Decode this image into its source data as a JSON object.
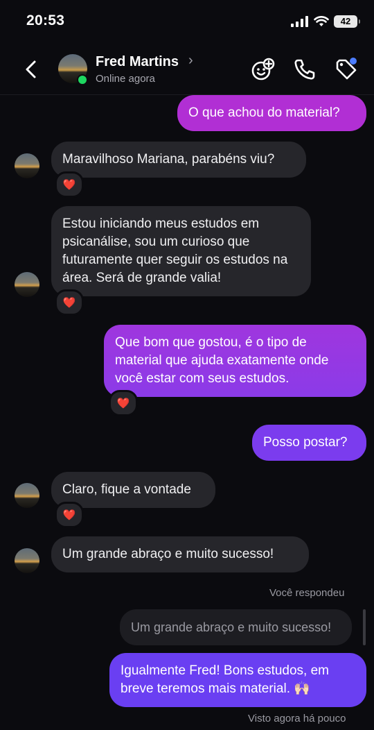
{
  "status_bar": {
    "time": "20:53",
    "battery": "42",
    "icons": [
      "signal-icon",
      "wifi-icon",
      "battery-icon"
    ]
  },
  "header": {
    "contact_name": "Fred Martins",
    "contact_status": "Online agora",
    "icons": [
      "back-icon",
      "effects-icon",
      "phone-icon",
      "tag-icon"
    ]
  },
  "colors": {
    "background": "#0b0b0f",
    "incoming_bubble": "#26262b",
    "outgoing_top": "#b12fd4",
    "outgoing_bottom": "#6a3ff2",
    "online": "#1ed760",
    "badge": "#4c7dff"
  },
  "messages": [
    {
      "side": "outgoing",
      "text": "O que achou do material?"
    },
    {
      "side": "incoming",
      "text": "Maravilhoso Mariana, parabéns viu?",
      "reaction": "❤️"
    },
    {
      "side": "incoming",
      "text": "Estou iniciando meus estudos em psicanálise, sou um curioso que futuramente quer seguir os estudos na área. Será de grande valia!",
      "reaction": "❤️"
    },
    {
      "side": "outgoing",
      "text": "Que bom que gostou, é o tipo de material que ajuda exatamente onde você estar com seus estudos.",
      "reaction": "❤️"
    },
    {
      "side": "outgoing",
      "text": "Posso postar?"
    },
    {
      "side": "incoming",
      "text": "Claro, fique a vontade",
      "reaction": "❤️"
    },
    {
      "side": "incoming",
      "text": "Um grande abraço e muito sucesso!"
    },
    {
      "side": "outgoing",
      "text": "Igualmente Fred! Bons estudos, em breve teremos mais material. 🙌🏻"
    }
  ],
  "reply": {
    "label": "Você respondeu",
    "quoted_text": "Um grande abraço e muito sucesso!"
  },
  "seen_text": "Visto agora há pouco"
}
